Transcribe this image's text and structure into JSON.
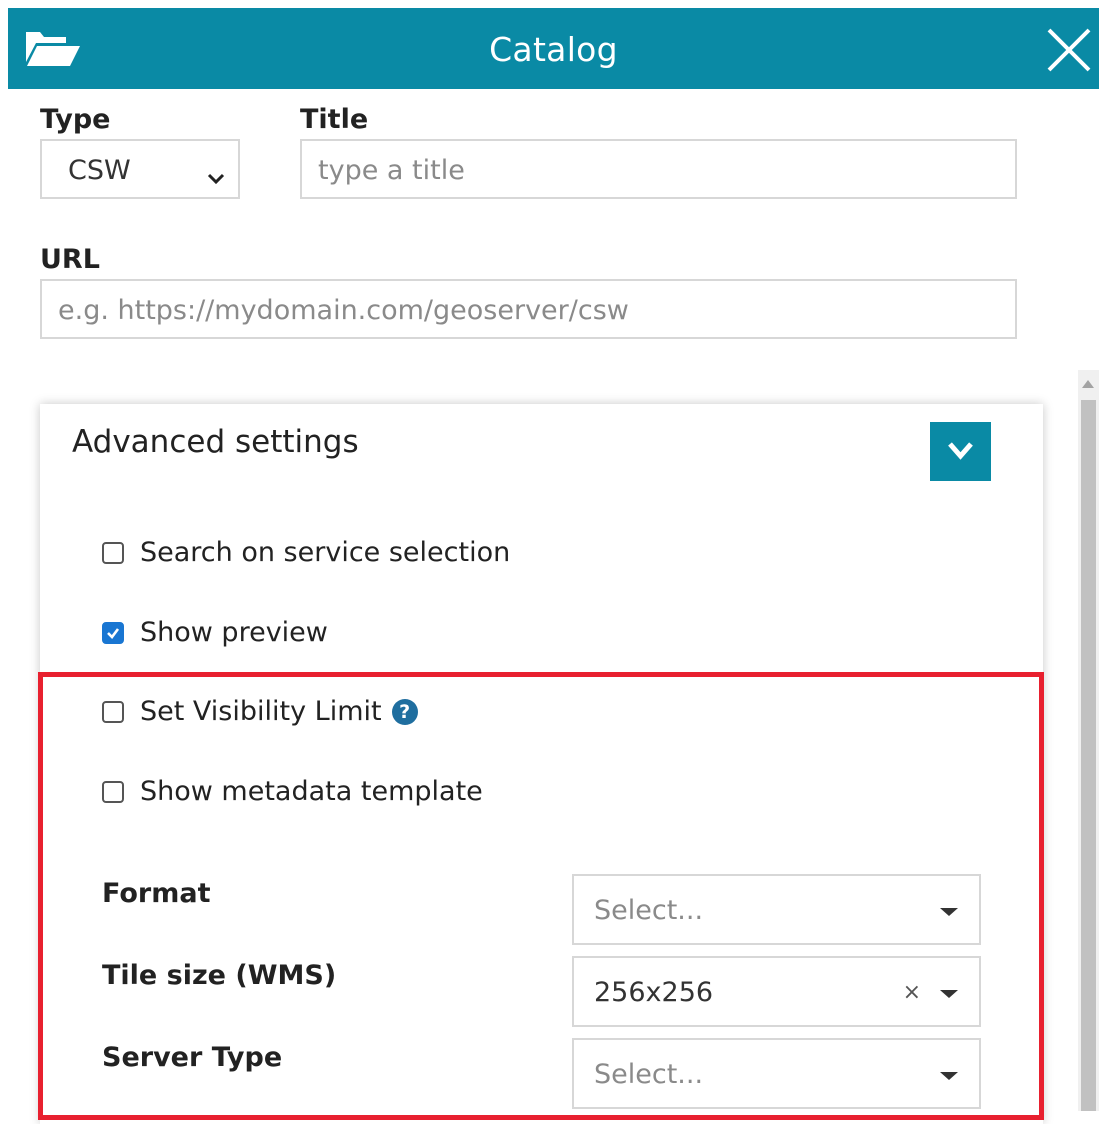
{
  "header": {
    "title": "Catalog",
    "folder_icon": "folder-open-icon",
    "close_icon": "close-icon",
    "color": "#0a8aa5"
  },
  "form": {
    "type": {
      "label": "Type",
      "value": "CSW"
    },
    "title": {
      "label": "Title",
      "placeholder": "type a title"
    },
    "url": {
      "label": "URL",
      "placeholder": "e.g. https://mydomain.com/geoserver/csw"
    }
  },
  "advanced": {
    "title": "Advanced settings",
    "options": [
      {
        "label": "Search on service selection",
        "checked": false
      },
      {
        "label": "Show preview",
        "checked": true
      },
      {
        "label": "Set Visibility Limit",
        "checked": false
      },
      {
        "label": "Show metadata template",
        "checked": false
      }
    ],
    "format": {
      "label": "Format",
      "placeholder": "Select..."
    },
    "tile_size": {
      "label": "Tile size (WMS)",
      "value": "256x256",
      "clear": "×"
    },
    "server_type": {
      "label": "Server Type",
      "placeholder": "Select..."
    },
    "help_glyph": "?",
    "highlight_color": "#e8202f"
  }
}
